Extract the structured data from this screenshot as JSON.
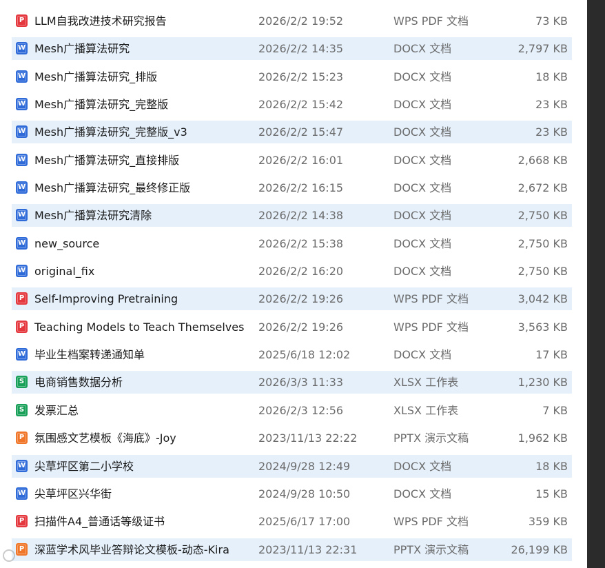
{
  "files": [
    {
      "name": "LLM自我改进技术研究报告",
      "date": "2026/2/2 19:52",
      "type": "WPS PDF 文档",
      "size": "73 KB",
      "icon": "pdf-icon"
    },
    {
      "name": "Mesh广播算法研究",
      "date": "2026/2/2 14:35",
      "type": "DOCX 文档",
      "size": "2,797 KB",
      "icon": "word-icon"
    },
    {
      "name": "Mesh广播算法研究_排版",
      "date": "2026/2/2 15:23",
      "type": "DOCX 文档",
      "size": "18 KB",
      "icon": "word-icon"
    },
    {
      "name": "Mesh广播算法研究_完整版",
      "date": "2026/2/2 15:42",
      "type": "DOCX 文档",
      "size": "23 KB",
      "icon": "word-icon"
    },
    {
      "name": "Mesh广播算法研究_完整版_v3",
      "date": "2026/2/2 15:47",
      "type": "DOCX 文档",
      "size": "23 KB",
      "icon": "word-icon"
    },
    {
      "name": "Mesh广播算法研究_直接排版",
      "date": "2026/2/2 16:01",
      "type": "DOCX 文档",
      "size": "2,668 KB",
      "icon": "word-icon"
    },
    {
      "name": "Mesh广播算法研究_最终修正版",
      "date": "2026/2/2 16:15",
      "type": "DOCX 文档",
      "size": "2,672 KB",
      "icon": "word-icon"
    },
    {
      "name": "Mesh广播算法研究清除",
      "date": "2026/2/2 14:38",
      "type": "DOCX 文档",
      "size": "2,750 KB",
      "icon": "word-icon"
    },
    {
      "name": "new_source",
      "date": "2026/2/2 15:38",
      "type": "DOCX 文档",
      "size": "2,750 KB",
      "icon": "word-icon"
    },
    {
      "name": "original_fix",
      "date": "2026/2/2 16:20",
      "type": "DOCX 文档",
      "size": "2,750 KB",
      "icon": "word-icon"
    },
    {
      "name": "Self-Improving Pretraining",
      "date": "2026/2/2 19:26",
      "type": "WPS PDF 文档",
      "size": "3,042 KB",
      "icon": "pdf-icon"
    },
    {
      "name": "Teaching Models to Teach Themselves",
      "date": "2026/2/2 19:26",
      "type": "WPS PDF 文档",
      "size": "3,563 KB",
      "icon": "pdf-icon"
    },
    {
      "name": "毕业生档案转递通知单",
      "date": "2025/6/18 12:02",
      "type": "DOCX 文档",
      "size": "17 KB",
      "icon": "word-icon"
    },
    {
      "name": "电商销售数据分析",
      "date": "2026/3/3 11:33",
      "type": "XLSX 工作表",
      "size": "1,230 KB",
      "icon": "sheet-icon"
    },
    {
      "name": "发票汇总",
      "date": "2026/2/3 12:56",
      "type": "XLSX 工作表",
      "size": "7 KB",
      "icon": "sheet-icon"
    },
    {
      "name": "氛围感文艺模板《海底》-Joy",
      "date": "2023/11/13 22:22",
      "type": "PPTX 演示文稿",
      "size": "1,962 KB",
      "icon": "presentation-icon"
    },
    {
      "name": "尖草坪区第二小学校",
      "date": "2024/9/28 12:49",
      "type": "DOCX 文档",
      "size": "18 KB",
      "icon": "word-icon"
    },
    {
      "name": "尖草坪区兴华街",
      "date": "2024/9/28 10:50",
      "type": "DOCX 文档",
      "size": "15 KB",
      "icon": "word-icon"
    },
    {
      "name": "扫描件A4_普通话等级证书",
      "date": "2025/6/17 17:00",
      "type": "WPS PDF 文档",
      "size": "359 KB",
      "icon": "pdf-icon"
    },
    {
      "name": "深蓝学术风毕业答辩论文模板-动态-Kira",
      "date": "2023/11/13 22:31",
      "type": "PPTX 演示文稿",
      "size": "26,199 KB",
      "icon": "presentation-icon"
    }
  ],
  "icon_glyphs": {
    "pdf-icon": {
      "glyph": "P",
      "class": "pdf"
    },
    "word-icon": {
      "glyph": "W",
      "class": "docx"
    },
    "sheet-icon": {
      "glyph": "S",
      "class": "xlsx"
    },
    "presentation-icon": {
      "glyph": "P",
      "class": "pptx"
    }
  },
  "highlighted_rows": [
    1,
    4,
    7,
    10,
    13,
    16,
    19
  ],
  "colors": {
    "row_highlight": "#e5f0fb",
    "word": "#2f6ad9",
    "pdf": "#e5383e",
    "sheet": "#18a058",
    "presentation": "#f0762a"
  }
}
